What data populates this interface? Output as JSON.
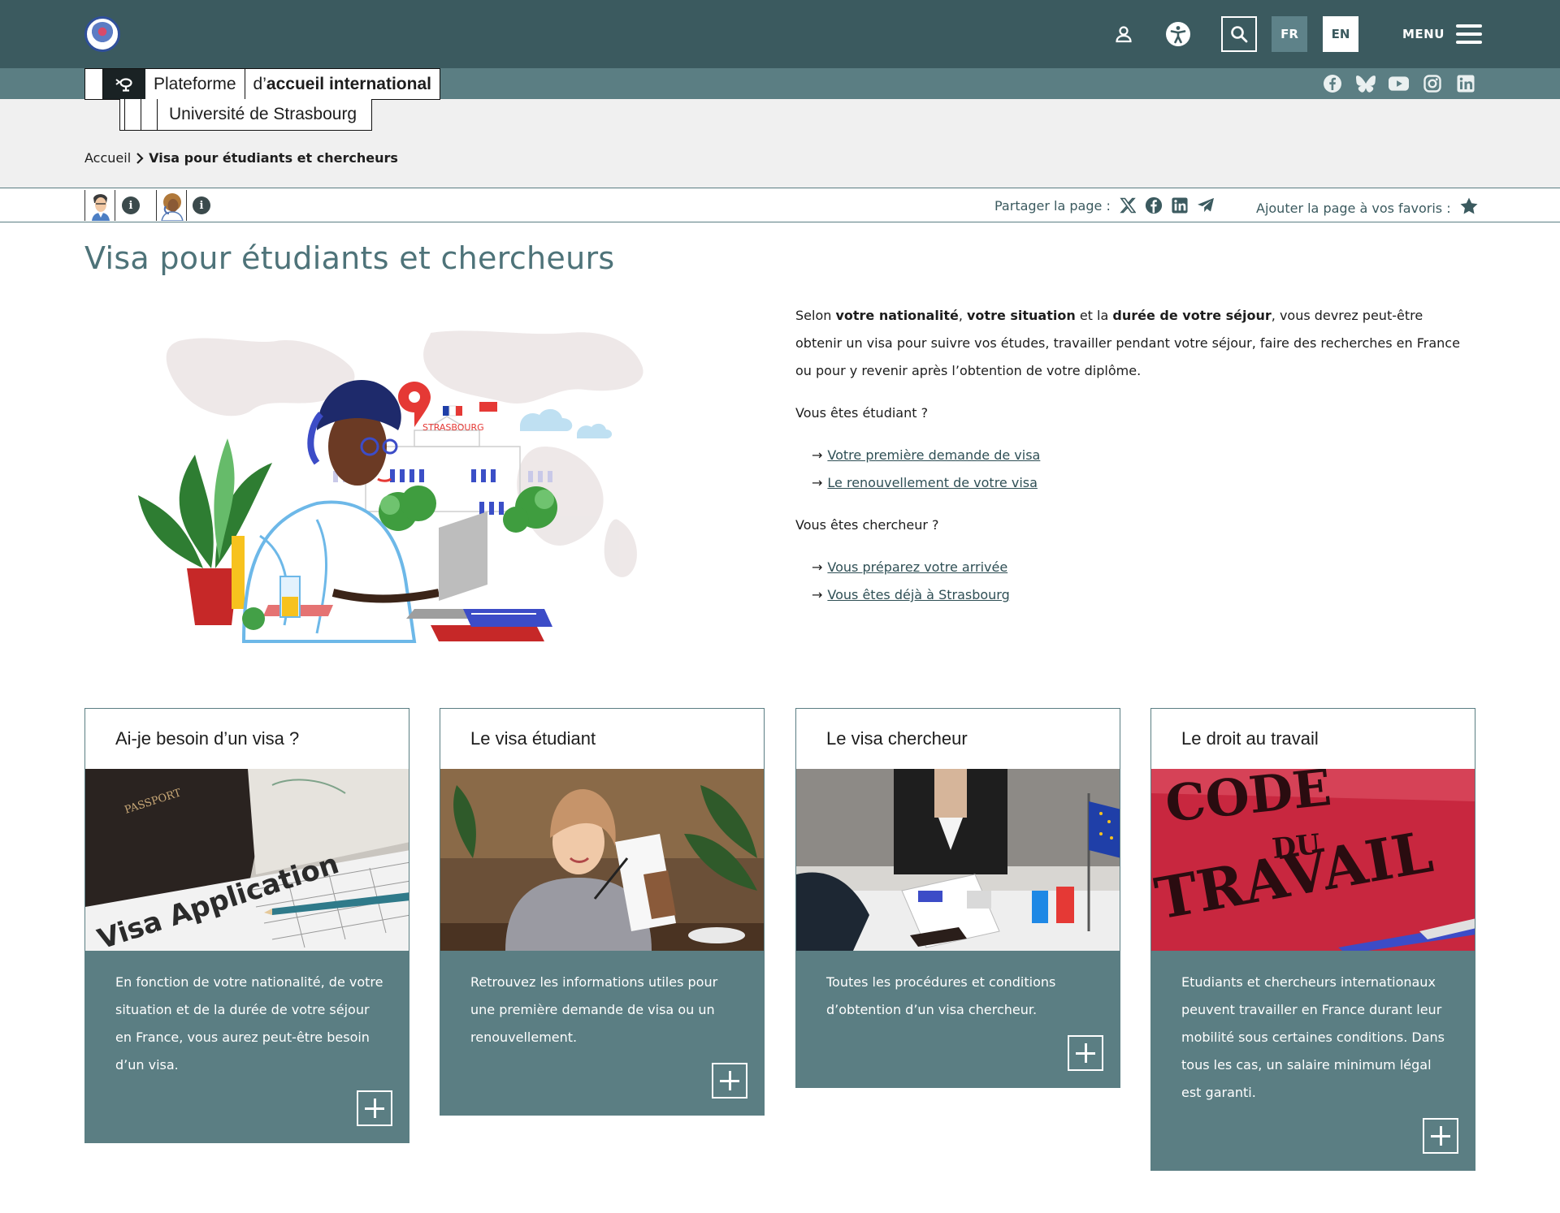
{
  "header": {
    "lang_fr": "FR",
    "lang_en": "EN",
    "menu_label": "MENU"
  },
  "brand": {
    "line1_a": "Plateforme",
    "line1_b_prefix": "d’",
    "line1_b_bold": "accueil international",
    "line2": "Université de Strasbourg"
  },
  "socials": [
    "facebook-icon",
    "bluesky-icon",
    "youtube-icon",
    "instagram-icon",
    "linkedin-icon"
  ],
  "breadcrumb": {
    "home": "Accueil",
    "current": "Visa pour étudiants et chercheurs"
  },
  "sharebar": {
    "share_label": "Partager la page :",
    "fav_label": "Ajouter la page à vos favoris :"
  },
  "page": {
    "title": "Visa pour étudiants et chercheurs"
  },
  "illustration": {
    "city_label": "STRASBOURG"
  },
  "intro": {
    "p1_a": "Selon ",
    "p1_b": "votre nationalité",
    "p1_c": ", ",
    "p1_d": "votre situation",
    "p1_e": " et la ",
    "p1_f": "durée de votre séjour",
    "p1_g": ", vous devrez peut-être obtenir un visa pour suivre vos études, travailler pendant votre séjour, faire des recherches en France ou pour y revenir après l’obtention de votre diplôme.",
    "student_q": "Vous êtes étudiant ?",
    "student_links": [
      "Votre première demande de visa",
      "Le renouvellement de votre visa"
    ],
    "researcher_q": "Vous êtes chercheur ?",
    "researcher_links": [
      "Vous préparez votre arrivée",
      "Vous êtes déjà à Strasbourg"
    ]
  },
  "cards": [
    {
      "title": "Ai-je besoin d’un visa ?",
      "text": "En fonction de votre nationalité, de votre situation et de la durée de votre séjour en France, vous aurez peut-être besoin d’un visa.",
      "img_text_1": "PASSPORT",
      "img_text_2": "Visa Application"
    },
    {
      "title": "Le visa étudiant",
      "text": "Retrouvez les informations utiles pour une première demande de visa ou un renouvellement."
    },
    {
      "title": "Le visa chercheur",
      "text": "Toutes les procédures et conditions d’obtention d’un visa chercheur."
    },
    {
      "title": "Le droit au travail",
      "text": "Etudiants et chercheurs internationaux peuvent travailler en France durant leur mobilité sous certaines conditions. Dans tous les cas, un salaire minimum légal est garanti.",
      "img_text_1": "CODE",
      "img_text_2": "DU",
      "img_text_3": "TRAVAIL"
    }
  ],
  "colors": {
    "topbar": "#3b5a5f",
    "accent": "#5b7e83",
    "title": "#4e7379"
  }
}
